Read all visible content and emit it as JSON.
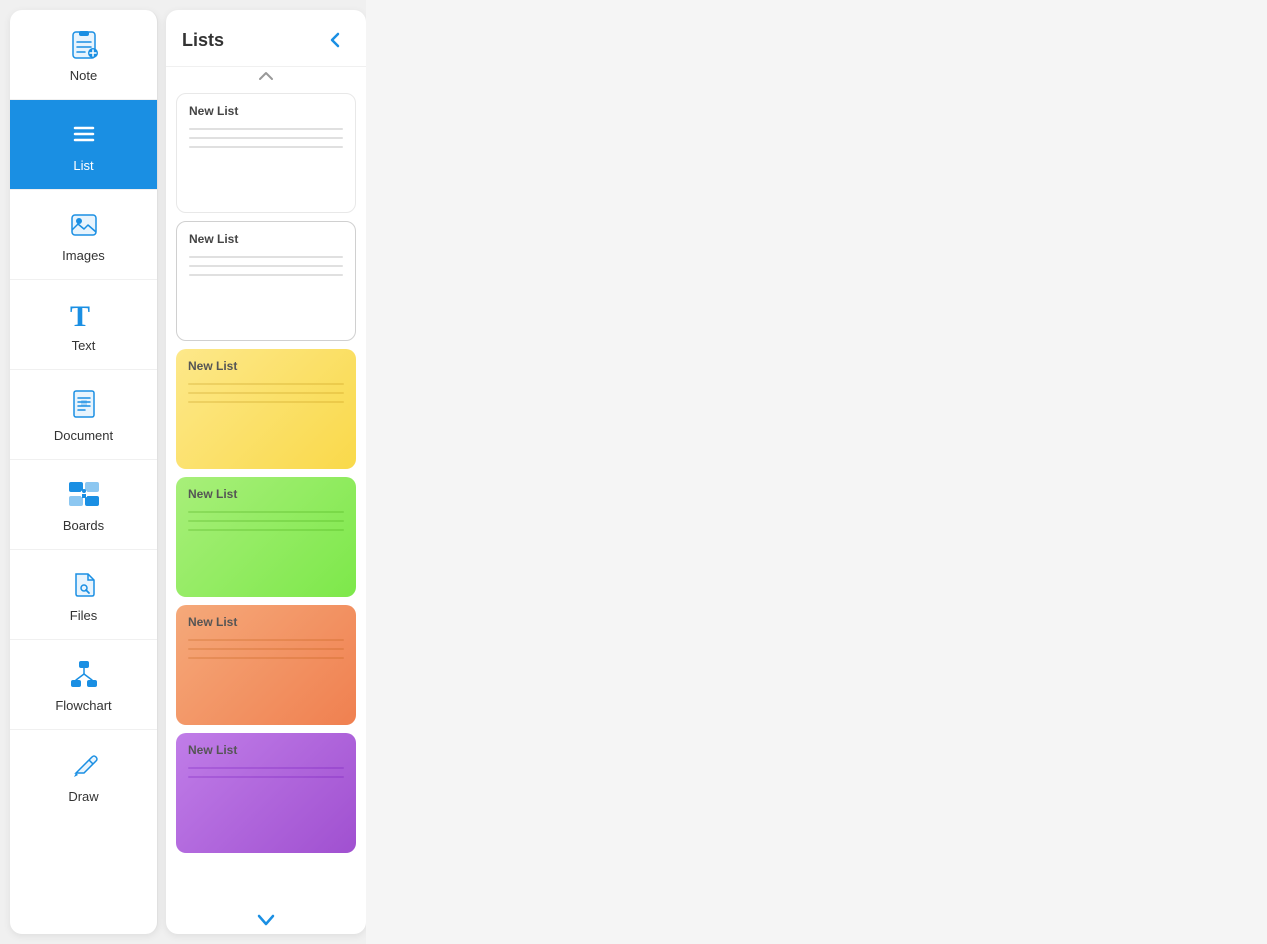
{
  "sidebar": {
    "items": [
      {
        "id": "note",
        "label": "Note",
        "icon": "note-icon",
        "active": false
      },
      {
        "id": "list",
        "label": "List",
        "icon": "list-icon",
        "active": true
      },
      {
        "id": "images",
        "label": "Images",
        "icon": "images-icon",
        "active": false
      },
      {
        "id": "text",
        "label": "Text",
        "icon": "text-icon",
        "active": false
      },
      {
        "id": "document",
        "label": "Document",
        "icon": "document-icon",
        "active": false
      },
      {
        "id": "boards",
        "label": "Boards",
        "icon": "boards-icon",
        "active": false
      },
      {
        "id": "files",
        "label": "Files",
        "icon": "files-icon",
        "active": false
      },
      {
        "id": "flowchart",
        "label": "Flowchart",
        "icon": "flowchart-icon",
        "active": false
      },
      {
        "id": "draw",
        "label": "Draw",
        "icon": "draw-icon",
        "active": false
      }
    ]
  },
  "panel": {
    "title": "Lists",
    "back_button_label": "‹",
    "scroll_up_label": "︿",
    "scroll_down_label": "∨",
    "cards": [
      {
        "id": "card-1",
        "title": "New List",
        "style": "white",
        "lines": 3
      },
      {
        "id": "card-2",
        "title": "New List",
        "style": "white-outline",
        "lines": 3
      },
      {
        "id": "card-3",
        "title": "New List",
        "style": "yellow",
        "lines": 3
      },
      {
        "id": "card-4",
        "title": "New List",
        "style": "green",
        "lines": 3
      },
      {
        "id": "card-5",
        "title": "New List",
        "style": "orange",
        "lines": 3
      },
      {
        "id": "card-6",
        "title": "New List",
        "style": "purple",
        "lines": 2
      }
    ]
  }
}
